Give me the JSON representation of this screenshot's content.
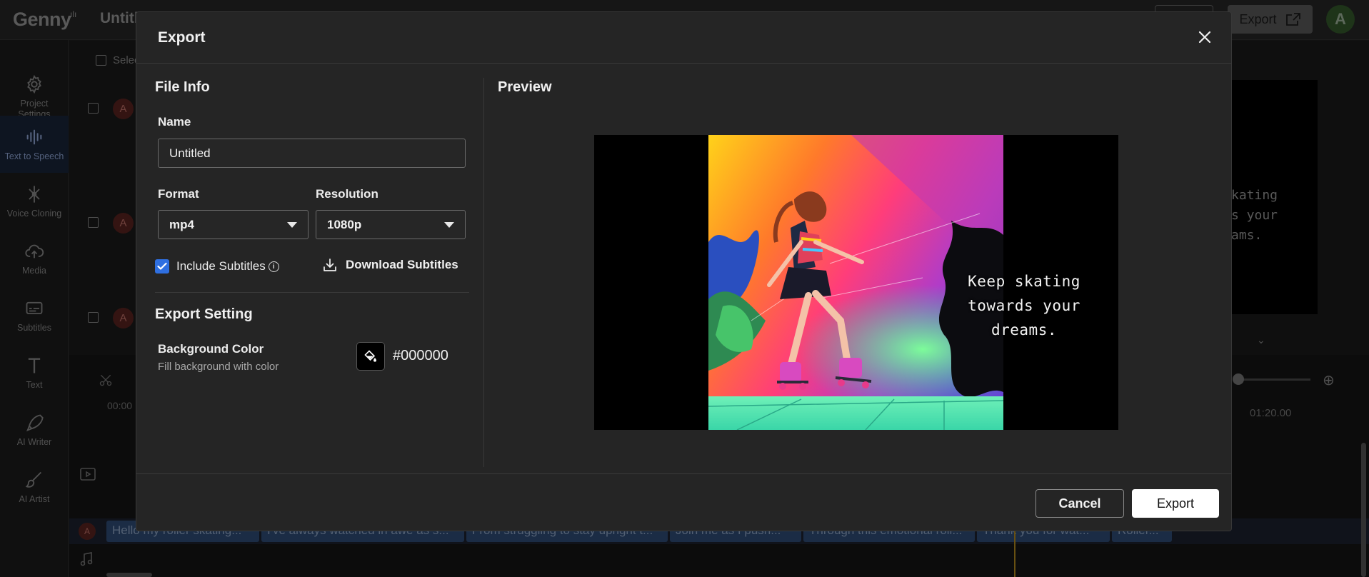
{
  "app": {
    "logo": "Genny",
    "project_title": "Untitled",
    "top_export_label": "Export",
    "user_initial": "A"
  },
  "sidebar": {
    "items": [
      {
        "label": "Project Settings",
        "icon": "gear-icon"
      },
      {
        "label": "Text to Speech",
        "icon": "waveform-icon"
      },
      {
        "label": "Voice Cloning",
        "icon": "voice-clone-icon"
      },
      {
        "label": "Media",
        "icon": "cloud-upload-icon"
      },
      {
        "label": "Subtitles",
        "icon": "subtitles-icon"
      },
      {
        "label": "Text",
        "icon": "text-icon"
      },
      {
        "label": "AI Writer",
        "icon": "pen-icon"
      },
      {
        "label": "AI Artist",
        "icon": "brush-icon"
      }
    ],
    "help": "?"
  },
  "background": {
    "select_label": "Selec",
    "row_avatar": "A",
    "preview_text": [
      "kating",
      "s your",
      "ams."
    ],
    "ruler_start": "00:00",
    "ruler_end": "01:20.00",
    "timeline_chips": [
      "Hello my roller skating...",
      "I've always watched in awe as s...",
      "From struggling to stay upright t...",
      "Join me as I push...",
      "Through this emotional roll...",
      "Thank you for wat...",
      "Roller..."
    ]
  },
  "modal": {
    "title": "Export",
    "file_info": {
      "heading": "File Info",
      "name_label": "Name",
      "name_value": "Untitled",
      "format_label": "Format",
      "format_value": "mp4",
      "resolution_label": "Resolution",
      "resolution_value": "1080p",
      "include_subtitles_label": "Include Subtitles",
      "include_subtitles_checked": true,
      "download_subtitles_label": "Download Subtitles"
    },
    "export_setting": {
      "heading": "Export Setting",
      "bg_color_label": "Background Color",
      "bg_color_desc": "Fill background with color",
      "bg_color_value": "#000000"
    },
    "preview": {
      "heading": "Preview",
      "subtitle_lines": [
        "Keep skating",
        "towards your",
        "dreams."
      ]
    },
    "footer": {
      "cancel_label": "Cancel",
      "export_label": "Export"
    }
  },
  "colors": {
    "accent": "#2f6fe0",
    "export_primary": "#ffffff",
    "preview_background": "#000000"
  }
}
